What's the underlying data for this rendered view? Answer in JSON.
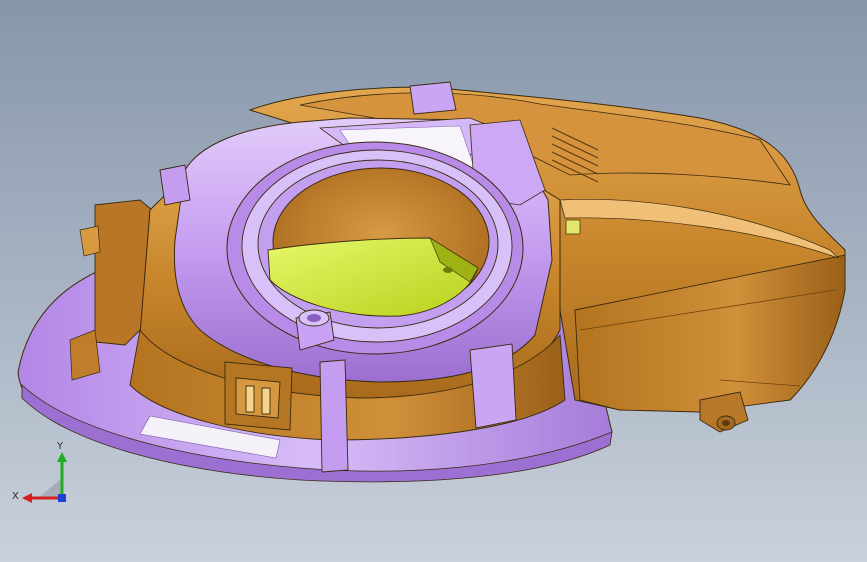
{
  "viewport": {
    "background_top": "#8796ab",
    "background_bottom": "#c9d1db"
  },
  "model": {
    "colors": {
      "housing": "#c8862c",
      "housing_dark": "#8e5a14",
      "housing_light": "#e2a64e",
      "shell": "#c59cf0",
      "shell_dark": "#8f62c6",
      "shell_light": "#e2ccfb",
      "insert": "#d6ee2a",
      "edge": "#3a2a10"
    }
  },
  "triad": {
    "x_label": "X",
    "y_label": "Y",
    "x_color": "#d62020",
    "y_color": "#1fae1f",
    "z_color": "#1c3fd6"
  }
}
